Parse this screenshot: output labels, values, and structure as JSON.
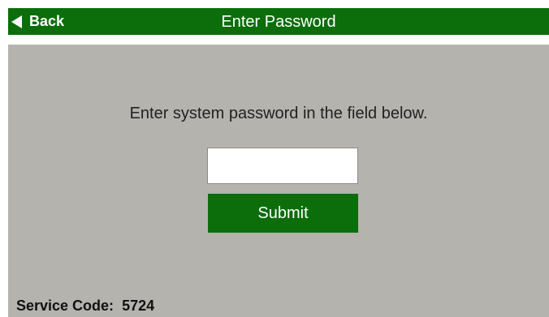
{
  "header": {
    "back_label": "Back",
    "back_icon": "triangle-left-icon",
    "title": "Enter Password"
  },
  "main": {
    "instruction": "Enter system password in the field below.",
    "password": {
      "value": "",
      "placeholder": ""
    },
    "submit_label": "Submit"
  },
  "footer": {
    "service_code_label": "Service Code:",
    "service_code_value": "5724"
  },
  "colors": {
    "header_green": "#0b6e0b",
    "panel_gray": "#b5b3ad",
    "text_white": "#ffffff"
  }
}
